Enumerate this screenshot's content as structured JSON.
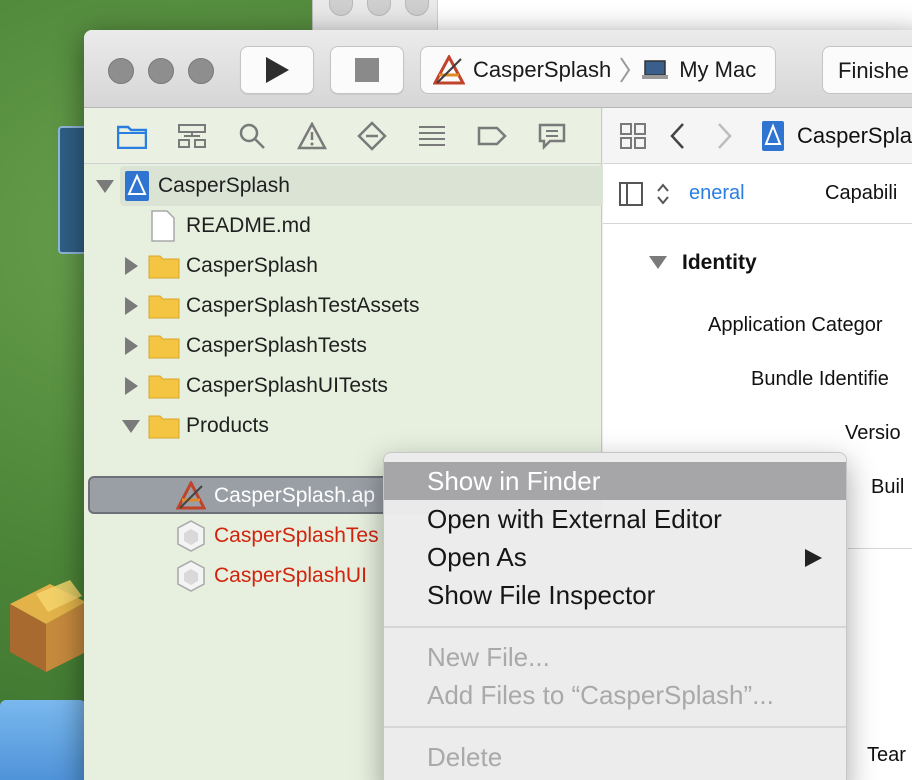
{
  "toolbar": {
    "scheme_project": "CasperSplash",
    "scheme_destination": "My Mac",
    "activity_status": "Finishe"
  },
  "navigator": {
    "tabs": [
      "project-navigator",
      "symbol-navigator",
      "find-navigator",
      "issue-navigator",
      "test-navigator",
      "debug-navigator",
      "breakpoint-navigator",
      "report-navigator"
    ],
    "tree": [
      {
        "label": "CasperSplash",
        "kind": "project",
        "state": "expanded"
      },
      {
        "label": "README.md",
        "kind": "file"
      },
      {
        "label": "CasperSplash",
        "kind": "folder",
        "state": "collapsed"
      },
      {
        "label": "CasperSplashTestAssets",
        "kind": "folder",
        "state": "collapsed"
      },
      {
        "label": "CasperSplashTests",
        "kind": "folder",
        "state": "collapsed"
      },
      {
        "label": "CasperSplashUITests",
        "kind": "folder",
        "state": "collapsed"
      },
      {
        "label": "Products",
        "kind": "folder",
        "state": "expanded"
      },
      {
        "label": "CasperSplash.ap",
        "kind": "app",
        "selected": true
      },
      {
        "label": "CasperSplashTes",
        "kind": "bundle",
        "missing": true
      },
      {
        "label": "CasperSplashUI",
        "kind": "bundle",
        "missing": true
      }
    ]
  },
  "editor": {
    "jump_file": "CasperSpla",
    "tab_general": "eneral",
    "tab_capabilities": "Capabili",
    "section_title": "Identity",
    "fields": [
      "Application Categor",
      "Bundle Identifie",
      "Versio",
      "Buil"
    ],
    "team_label": "Tear"
  },
  "context_menu": {
    "items": [
      {
        "label": "Show in Finder",
        "state": "highlighted"
      },
      {
        "label": "Open with External Editor",
        "state": "normal"
      },
      {
        "label": "Open As",
        "state": "normal",
        "submenu": true
      },
      {
        "label": "Show File Inspector",
        "state": "normal"
      },
      {
        "label": "New File...",
        "state": "disabled"
      },
      {
        "label": "Add Files to “CasperSplash”...",
        "state": "disabled"
      },
      {
        "label": "Delete",
        "state": "disabled"
      }
    ]
  },
  "colors": {
    "missing_file_text": "#d2230f",
    "navigator_bg": "#e7f0df",
    "menu_highlight": "#a6a6a9",
    "link_blue": "#2a7de1"
  }
}
